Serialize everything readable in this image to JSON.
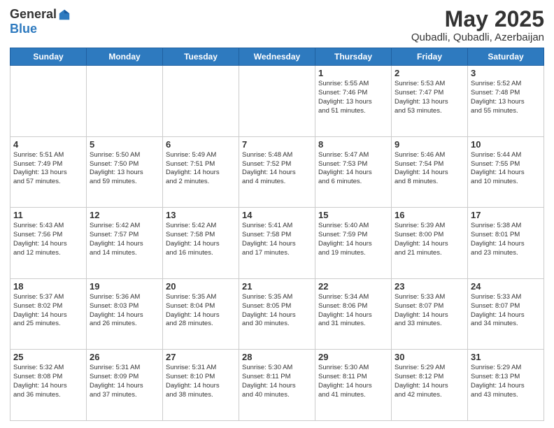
{
  "logo": {
    "general": "General",
    "blue": "Blue"
  },
  "header": {
    "month": "May 2025",
    "location": "Qubadli, Qubadli, Azerbaijan"
  },
  "days_of_week": [
    "Sunday",
    "Monday",
    "Tuesday",
    "Wednesday",
    "Thursday",
    "Friday",
    "Saturday"
  ],
  "weeks": [
    [
      {
        "day": "",
        "info": ""
      },
      {
        "day": "",
        "info": ""
      },
      {
        "day": "",
        "info": ""
      },
      {
        "day": "",
        "info": ""
      },
      {
        "day": "1",
        "info": "Sunrise: 5:55 AM\nSunset: 7:46 PM\nDaylight: 13 hours\nand 51 minutes."
      },
      {
        "day": "2",
        "info": "Sunrise: 5:53 AM\nSunset: 7:47 PM\nDaylight: 13 hours\nand 53 minutes."
      },
      {
        "day": "3",
        "info": "Sunrise: 5:52 AM\nSunset: 7:48 PM\nDaylight: 13 hours\nand 55 minutes."
      }
    ],
    [
      {
        "day": "4",
        "info": "Sunrise: 5:51 AM\nSunset: 7:49 PM\nDaylight: 13 hours\nand 57 minutes."
      },
      {
        "day": "5",
        "info": "Sunrise: 5:50 AM\nSunset: 7:50 PM\nDaylight: 13 hours\nand 59 minutes."
      },
      {
        "day": "6",
        "info": "Sunrise: 5:49 AM\nSunset: 7:51 PM\nDaylight: 14 hours\nand 2 minutes."
      },
      {
        "day": "7",
        "info": "Sunrise: 5:48 AM\nSunset: 7:52 PM\nDaylight: 14 hours\nand 4 minutes."
      },
      {
        "day": "8",
        "info": "Sunrise: 5:47 AM\nSunset: 7:53 PM\nDaylight: 14 hours\nand 6 minutes."
      },
      {
        "day": "9",
        "info": "Sunrise: 5:46 AM\nSunset: 7:54 PM\nDaylight: 14 hours\nand 8 minutes."
      },
      {
        "day": "10",
        "info": "Sunrise: 5:44 AM\nSunset: 7:55 PM\nDaylight: 14 hours\nand 10 minutes."
      }
    ],
    [
      {
        "day": "11",
        "info": "Sunrise: 5:43 AM\nSunset: 7:56 PM\nDaylight: 14 hours\nand 12 minutes."
      },
      {
        "day": "12",
        "info": "Sunrise: 5:42 AM\nSunset: 7:57 PM\nDaylight: 14 hours\nand 14 minutes."
      },
      {
        "day": "13",
        "info": "Sunrise: 5:42 AM\nSunset: 7:58 PM\nDaylight: 14 hours\nand 16 minutes."
      },
      {
        "day": "14",
        "info": "Sunrise: 5:41 AM\nSunset: 7:58 PM\nDaylight: 14 hours\nand 17 minutes."
      },
      {
        "day": "15",
        "info": "Sunrise: 5:40 AM\nSunset: 7:59 PM\nDaylight: 14 hours\nand 19 minutes."
      },
      {
        "day": "16",
        "info": "Sunrise: 5:39 AM\nSunset: 8:00 PM\nDaylight: 14 hours\nand 21 minutes."
      },
      {
        "day": "17",
        "info": "Sunrise: 5:38 AM\nSunset: 8:01 PM\nDaylight: 14 hours\nand 23 minutes."
      }
    ],
    [
      {
        "day": "18",
        "info": "Sunrise: 5:37 AM\nSunset: 8:02 PM\nDaylight: 14 hours\nand 25 minutes."
      },
      {
        "day": "19",
        "info": "Sunrise: 5:36 AM\nSunset: 8:03 PM\nDaylight: 14 hours\nand 26 minutes."
      },
      {
        "day": "20",
        "info": "Sunrise: 5:35 AM\nSunset: 8:04 PM\nDaylight: 14 hours\nand 28 minutes."
      },
      {
        "day": "21",
        "info": "Sunrise: 5:35 AM\nSunset: 8:05 PM\nDaylight: 14 hours\nand 30 minutes."
      },
      {
        "day": "22",
        "info": "Sunrise: 5:34 AM\nSunset: 8:06 PM\nDaylight: 14 hours\nand 31 minutes."
      },
      {
        "day": "23",
        "info": "Sunrise: 5:33 AM\nSunset: 8:07 PM\nDaylight: 14 hours\nand 33 minutes."
      },
      {
        "day": "24",
        "info": "Sunrise: 5:33 AM\nSunset: 8:07 PM\nDaylight: 14 hours\nand 34 minutes."
      }
    ],
    [
      {
        "day": "25",
        "info": "Sunrise: 5:32 AM\nSunset: 8:08 PM\nDaylight: 14 hours\nand 36 minutes."
      },
      {
        "day": "26",
        "info": "Sunrise: 5:31 AM\nSunset: 8:09 PM\nDaylight: 14 hours\nand 37 minutes."
      },
      {
        "day": "27",
        "info": "Sunrise: 5:31 AM\nSunset: 8:10 PM\nDaylight: 14 hours\nand 38 minutes."
      },
      {
        "day": "28",
        "info": "Sunrise: 5:30 AM\nSunset: 8:11 PM\nDaylight: 14 hours\nand 40 minutes."
      },
      {
        "day": "29",
        "info": "Sunrise: 5:30 AM\nSunset: 8:11 PM\nDaylight: 14 hours\nand 41 minutes."
      },
      {
        "day": "30",
        "info": "Sunrise: 5:29 AM\nSunset: 8:12 PM\nDaylight: 14 hours\nand 42 minutes."
      },
      {
        "day": "31",
        "info": "Sunrise: 5:29 AM\nSunset: 8:13 PM\nDaylight: 14 hours\nand 43 minutes."
      }
    ]
  ]
}
